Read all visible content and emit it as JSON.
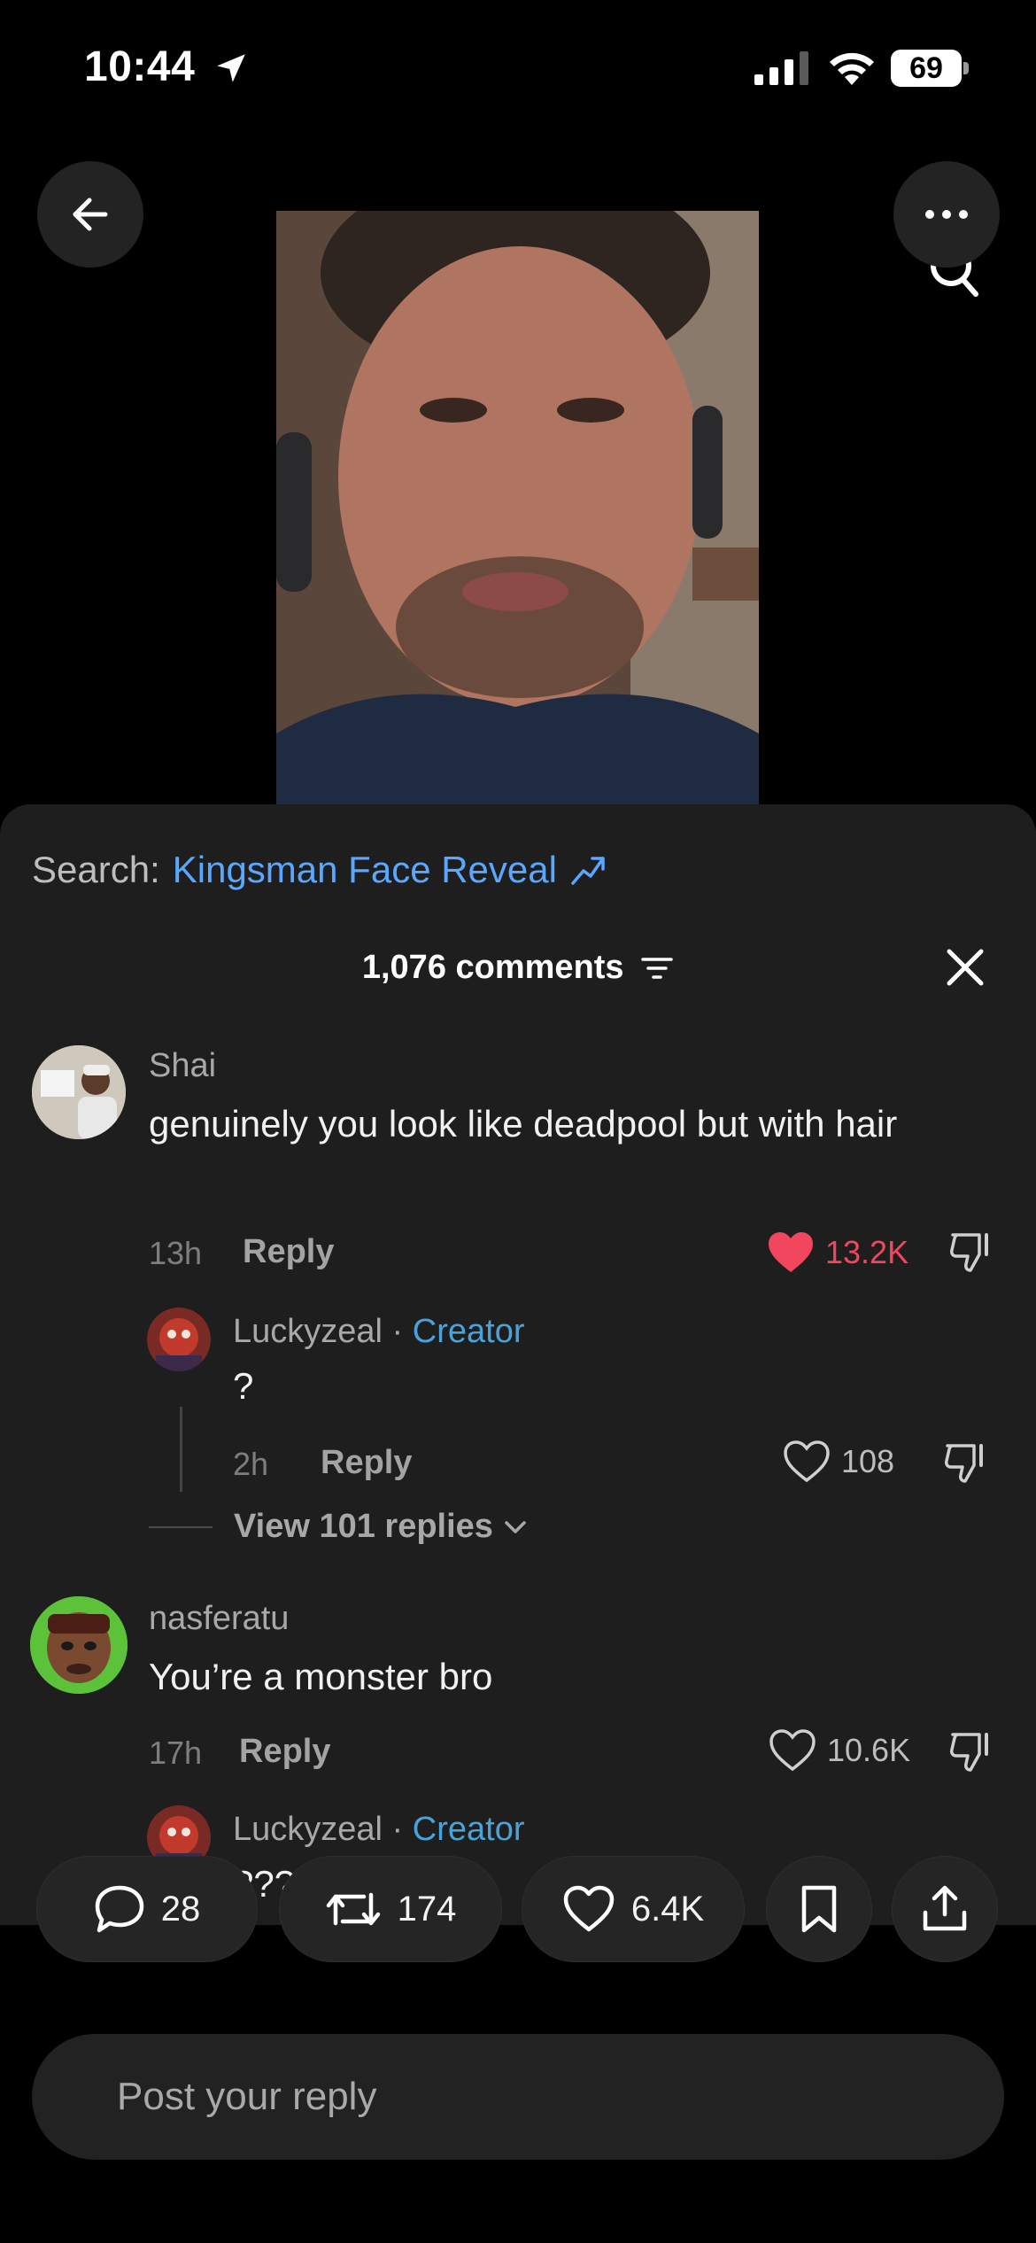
{
  "status_bar": {
    "time": "10:44",
    "battery": "69"
  },
  "search": {
    "prefix": "Search:",
    "term": "Kingsman Face Reveal"
  },
  "comments_header": {
    "count_label": "1,076 comments"
  },
  "comments": [
    {
      "username": "Shai",
      "text": "genuinely you look like deadpool but with hair",
      "time": "13h",
      "reply_label": "Reply",
      "likes": "13.2K",
      "liked": true
    },
    {
      "username": "Luckyzeal",
      "separator": "·",
      "creator_label": "Creator",
      "text": "?",
      "time": "2h",
      "reply_label": "Reply",
      "likes": "108"
    },
    {
      "username": "nasferatu",
      "text": "You’re a monster bro",
      "time": "17h",
      "reply_label": "Reply",
      "likes": "10.6K"
    },
    {
      "username": "Luckyzeal",
      "separator": "·",
      "creator_label": "Creator",
      "text": "???"
    }
  ],
  "view_replies": "View 101 replies",
  "actions": {
    "comments": "28",
    "reposts": "174",
    "likes": "6.4K"
  },
  "composer": {
    "placeholder": "Post your reply"
  },
  "colors": {
    "accent_link": "#5aa7ff",
    "creator": "#49a3d8",
    "liked": "#f1465e",
    "sheet_bg": "#1e1e1e"
  },
  "icons": [
    "location-arrow-icon",
    "cellular-signal-icon",
    "wifi-icon",
    "battery-icon",
    "back-arrow-icon",
    "more-dots-icon",
    "search-icon",
    "trending-icon",
    "filter-icon",
    "close-icon",
    "heart-icon",
    "dislike-icon",
    "chevron-down-icon",
    "comment-bubble-icon",
    "repost-icon",
    "bookmark-icon",
    "share-icon"
  ]
}
